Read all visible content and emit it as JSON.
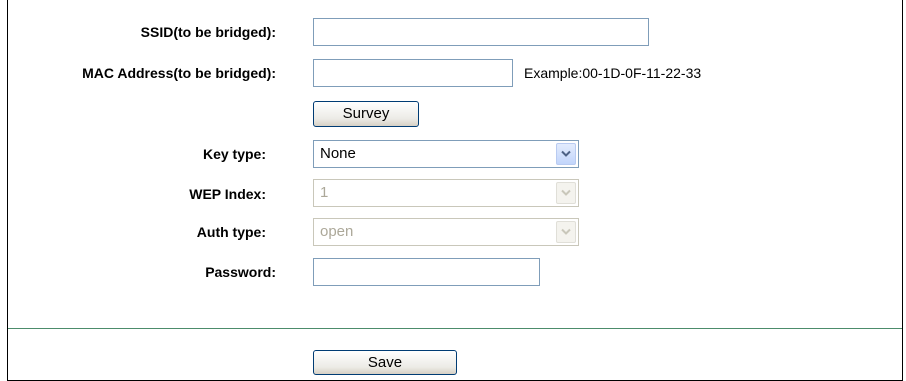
{
  "form": {
    "ssid": {
      "label": "SSID(to be bridged):",
      "value": ""
    },
    "mac": {
      "label": "MAC Address(to be bridged):",
      "value": "",
      "hint": "Example:00-1D-0F-11-22-33"
    },
    "survey_label": "Survey",
    "key_type": {
      "label": "Key type:",
      "selected": "None",
      "enabled": true
    },
    "wep_index": {
      "label": "WEP Index:",
      "selected": "1",
      "enabled": false
    },
    "auth_type": {
      "label": "Auth type:",
      "selected": "open",
      "enabled": false
    },
    "password": {
      "label": "Password:",
      "value": ""
    }
  },
  "footer": {
    "save_label": "Save"
  },
  "colors": {
    "divider": "#4c8c6b",
    "input_border": "#7f9db9",
    "disabled_text": "#aca899"
  },
  "icons": {
    "dropdown": "chevron-down-icon"
  }
}
